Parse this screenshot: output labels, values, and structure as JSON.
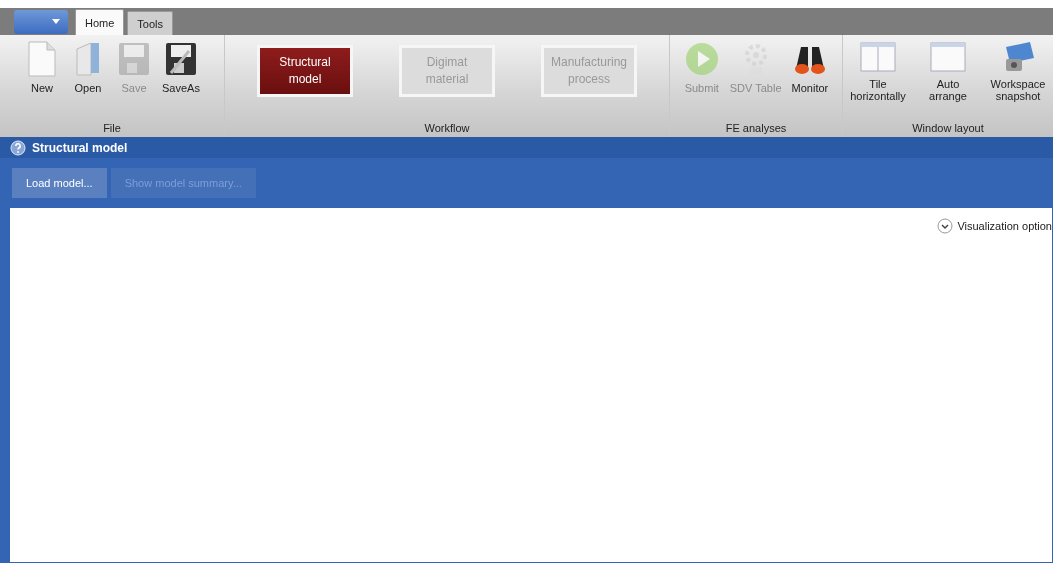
{
  "tabs": [
    {
      "label": "Home",
      "selected": true
    },
    {
      "label": "Tools",
      "selected": false
    }
  ],
  "ribbon": [
    {
      "label": "File",
      "kind": "icons",
      "items": [
        {
          "label": "New",
          "disabled": false
        },
        {
          "label": "Open",
          "disabled": false
        },
        {
          "label": "Save",
          "disabled": true
        },
        {
          "label": "SaveAs",
          "disabled": false
        }
      ]
    },
    {
      "label": "Workflow",
      "kind": "steps",
      "items": [
        {
          "label": "Structural model",
          "selected": true
        },
        {
          "label": "Digimat material",
          "selected": false
        },
        {
          "label": "Manufacturing process",
          "selected": false
        }
      ]
    },
    {
      "label": "FE analyses",
      "kind": "icons",
      "items": [
        {
          "label": "Submit",
          "disabled": true
        },
        {
          "label": "SDV Table",
          "disabled": true
        },
        {
          "label": "Monitor",
          "disabled": false
        }
      ]
    },
    {
      "label": "Window layout",
      "kind": "icons",
      "items": [
        {
          "label": "Tile horizontally",
          "disabled": false
        },
        {
          "label": "Auto arrange",
          "disabled": false
        },
        {
          "label": "Workspace snapshot",
          "disabled": false
        }
      ]
    }
  ],
  "panel": {
    "title": "Structural model",
    "buttons": [
      {
        "label": "Load model...",
        "disabled": false
      },
      {
        "label": "Show model summary...",
        "disabled": true
      }
    ],
    "options_label": "Visualization option"
  }
}
